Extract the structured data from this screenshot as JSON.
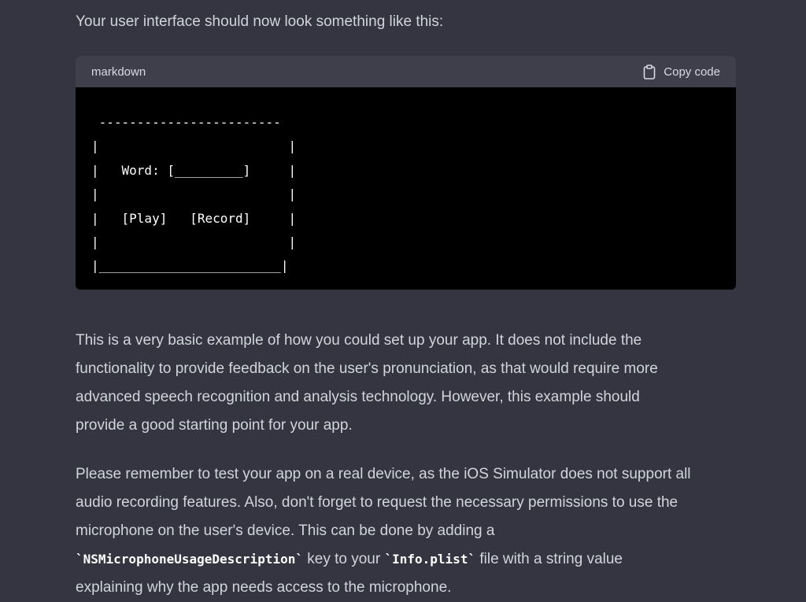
{
  "intro": "Your user interface should now look something like this:",
  "code_block": {
    "language": "markdown",
    "copy_label": "Copy code",
    "lines": [
      " ------------------------",
      "|                         |",
      "|   Word: [_________]     |",
      "|                         |",
      "|   [Play]   [Record]     |",
      "|                         |",
      "|________________________|"
    ]
  },
  "paragraph1": {
    "lines": [
      "This is a very basic example of how you could set up your app. It does not include the",
      "functionality to provide feedback on the user's pronunciation, as that would require more",
      "advanced speech recognition and analysis technology. However, this example should",
      "provide a good starting point for your app."
    ]
  },
  "paragraph2": {
    "line1": "Please remember to test your app on a real device, as the iOS Simulator does not support all",
    "line2": "audio recording features. Also, don't forget to request the necessary permissions to use the",
    "line3": "microphone on the user's device. This can be done by adding a",
    "code1": "`NSMicrophoneUsageDescription`",
    "text_mid": " key to your ",
    "code2": "`Info.plist`",
    "text_end": " file with a string value",
    "line5": "explaining why the app needs access to the microphone."
  }
}
